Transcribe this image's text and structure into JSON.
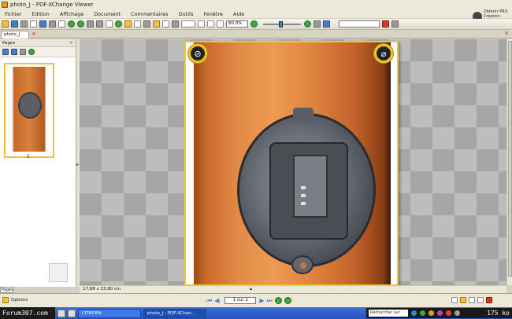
{
  "window": {
    "title": "photo_J - PDF-XChange Viewer"
  },
  "menu": [
    "Fichier",
    "Edition",
    "Affichage",
    "Document",
    "Commentaires",
    "Outils",
    "Fenêtre",
    "Aide"
  ],
  "brand": {
    "line1": "Obtenir PRO",
    "line2": "Création Tools"
  },
  "toolbar": {
    "zoom_value": "80,0%"
  },
  "doc_tab": {
    "label": "photo_J"
  },
  "sidebar": {
    "title": "Pages",
    "page_number": "1",
    "bottom_tab": "Pages"
  },
  "status": {
    "page_size": "17,88 x 23,80 cm",
    "options_label": "Options",
    "page_counter": "1 sur 1"
  },
  "taskbar": {
    "watermark": "Forum307.com",
    "items": [
      "CITROEN",
      "photo_J - PDF-XChan..."
    ],
    "search_placeholder": "Rechercher sur le...",
    "clock": "175 ko"
  },
  "icons": [
    "search-icon",
    "zoom-in-icon",
    "zoom-out-icon",
    "hand-icon",
    "select-icon",
    "print-icon",
    "save-icon",
    "open-icon",
    "close-icon",
    "first-page-icon",
    "prev-page-icon",
    "next-page-icon",
    "last-page-icon"
  ],
  "colors": {
    "accent_yellow": "#f0c828",
    "toolbar_bg": "#ece9d8",
    "taskbar_blue": "#2454c0"
  }
}
